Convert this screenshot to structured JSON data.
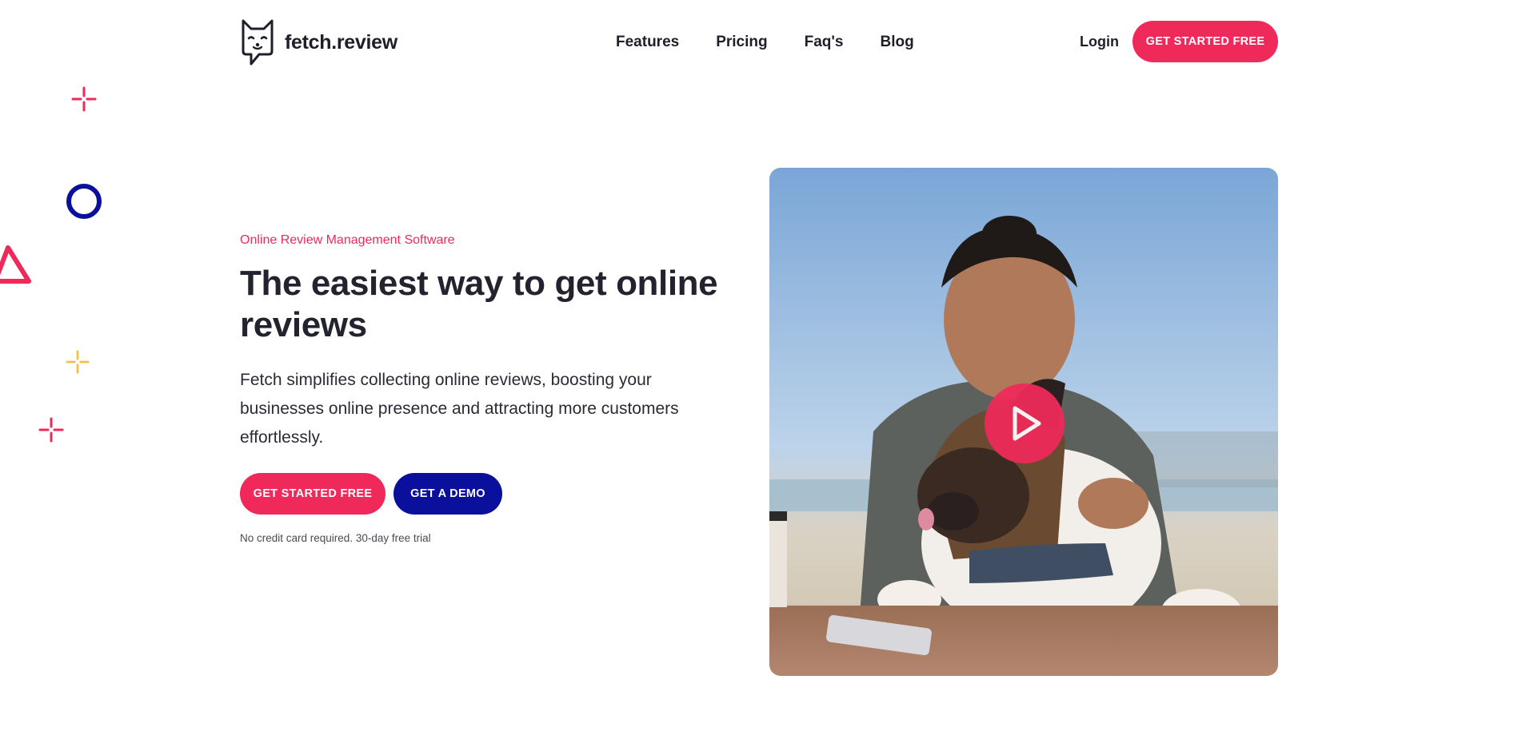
{
  "brand": {
    "name": "fetch.review",
    "logo_icon": "dog-face-icon",
    "accent_color": "#ef2a5a",
    "secondary_color": "#0a0f9c"
  },
  "nav": {
    "items": [
      {
        "label": "Features"
      },
      {
        "label": "Pricing"
      },
      {
        "label": "Faq's"
      },
      {
        "label": "Blog"
      }
    ],
    "login_label": "Login",
    "cta_label": "GET STARTED FREE"
  },
  "hero": {
    "eyebrow": "Online Review Management Software",
    "headline": "The easiest way to get online reviews",
    "description": "Fetch simplifies collecting online reviews, boosting your businesses online presence and attracting more customers effortlessly.",
    "primary_cta": "GET STARTED FREE",
    "secondary_cta": "GET A DEMO",
    "note": "No credit card required. 30-day free trial",
    "media_icon": "play-icon"
  },
  "decorations": {
    "icons": [
      "plus-sparkle-icon",
      "circle-outline-icon",
      "triangle-outline-icon",
      "plus-sparkle-icon",
      "plus-sparkle-icon"
    ],
    "colors": [
      "#ef2a5a",
      "#0a0f9c",
      "#f5c142"
    ]
  }
}
